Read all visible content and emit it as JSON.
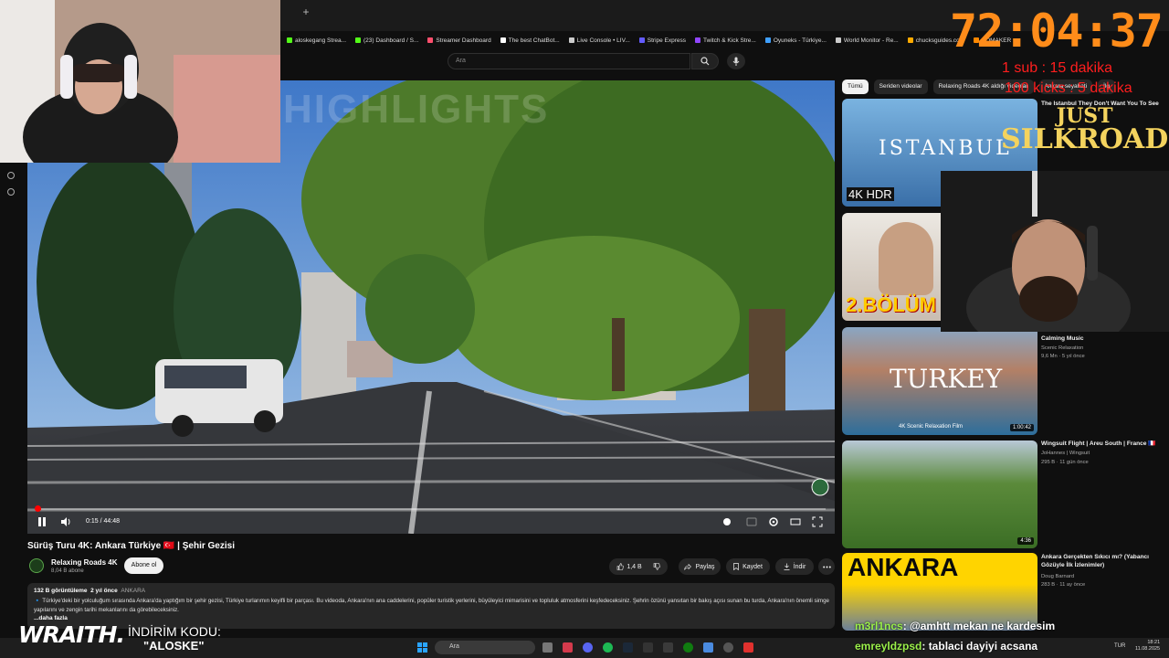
{
  "browser": {
    "new_tab": "+",
    "bookmarks": [
      {
        "label": "aloskegang Strea...",
        "color": "#53fc18"
      },
      {
        "label": "(23) Dashboard / S...",
        "color": "#53fc18"
      },
      {
        "label": "Streamer Dashboard",
        "color": "#ff4f6d"
      },
      {
        "label": "The best ChatBot...",
        "color": "#ffffff"
      },
      {
        "label": "Live Console • LIV...",
        "color": "#cccccc"
      },
      {
        "label": "Stripe Express",
        "color": "#635bff"
      },
      {
        "label": "Twitch & Kick Stre...",
        "color": "#9146ff"
      },
      {
        "label": "Oyuneks - Türkiye...",
        "color": "#3fa0ff"
      },
      {
        "label": "World Monitor - Re...",
        "color": "#cccccc"
      },
      {
        "label": "chucksguides.co...",
        "color": "#ffaa00"
      },
      {
        "label": "TOMAKER",
        "color": "#ff8800"
      }
    ]
  },
  "search": {
    "placeholder": "Ara",
    "search_icon": "search-icon",
    "mic_icon": "mic-icon"
  },
  "player": {
    "watermark": "HIGHLIGHTS",
    "time": "0:15 / 44:48",
    "progress_fraction": 0.006
  },
  "video": {
    "title": "Sürüş Turu 4K: Ankara Türkiye 🇹🇷 | Şehir Gezisi",
    "channel": "Relaxing Roads 4K",
    "subs": "8,04 B abone",
    "subscribe": "Abone ol",
    "likes": "1,4 B",
    "share": "Paylaş",
    "save": "Kaydet",
    "download": "İndir",
    "views": "132 B görüntüleme",
    "date": "2 yıl önce",
    "tag": "ANKARA",
    "description": "🔹 Türkiye'deki bir yolculuğum sırasında Ankara'da yaptığım bir şehir gezisi, Türkiye turlarımın keyifli bir parçası. Bu videoda, Ankara'nın ana caddelerini, popüler turistik yerlerini, büyüleyici mimarisini ve topluluk atmosferini keşfedeceksiniz. Şehrin özünü yansıtan bir bakış açısı sunan bu turda, Ankara'nın önemli simge yapılarını ve zengin tarihi mekanlarını da görebileceksiniz.",
    "more": "...daha fazla"
  },
  "chips": [
    "Tümü",
    "Seriden videolar",
    "Relaxing Roads 4K aldığı videolar",
    "Ankara seyahati",
    "İlg"
  ],
  "recs": [
    {
      "title": "The Istanbul They Don't Want You To See",
      "channel": "",
      "meta": "",
      "duration": "",
      "thumb_text": "ISTANBUL",
      "badge": "4K HDR"
    },
    {
      "title": "",
      "channel": "",
      "meta": "",
      "duration": "",
      "thumb_text": "2.BÖLÜM",
      "badge": ""
    },
    {
      "title": "Calming Music",
      "channel": "Scenic Relaxation",
      "meta": "9,6 Mn · 5 yıl önce",
      "duration": "1:00:42",
      "thumb_text": "TURKEY",
      "badge": "4K Scenic Relaxation Film"
    },
    {
      "title": "Wingsuit Flight | Areu South | France 🇫🇷",
      "channel": "JoHannes | Wingsuit",
      "meta": "295 B · 11 gün önce",
      "duration": "4:36",
      "thumb_text": "",
      "badge": ""
    },
    {
      "title": "Ankara Gerçekten Sıkıcı mı? (Yabancı Gözüyle İlk İzlenimler)",
      "channel": "Doug Barnard",
      "meta": "283 B · 11 ay önce",
      "duration": "",
      "thumb_text": "ANKARA",
      "badge": ""
    }
  ],
  "overlay": {
    "timer": "72:04:37",
    "sub_rule": "1 sub : 15 dakika",
    "kick_rule": "100 kicks : 5 dakika",
    "silkroad_line1": "JUST",
    "silkroad_line2": "SILKROAD",
    "chat": [
      {
        "user": "m3rl1ncs",
        "text": ": @amhtt mekan ne kardesim"
      },
      {
        "user": "emreyldzpsd",
        "text": ": tablaci dayiyi acsana"
      }
    ],
    "sponsor": "WRAITH.",
    "promo_label": "İNDİRİM KODU:",
    "promo_code": "\"ALOSKE\""
  },
  "taskbar": {
    "search": "Ara",
    "lang": "TUR",
    "time": "18:21",
    "date": "11.08.2025"
  },
  "colors": {
    "accent": "#ff0000",
    "timer": "#ff8c1a",
    "rules": "#ff1e1e",
    "chat_user": "#9bf04a"
  }
}
